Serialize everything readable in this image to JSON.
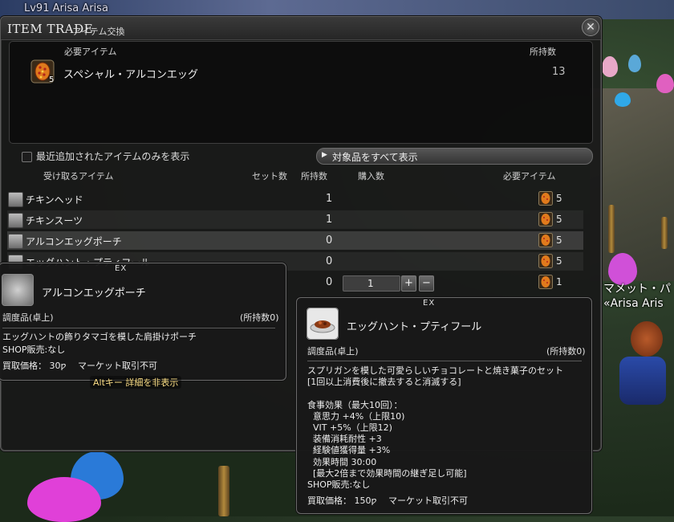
{
  "background": {
    "top_nameplate": "Lv91 Arisa Arisa",
    "right_nameplate_1": "マメット・パ",
    "right_nameplate_2": "«Arisa Aris"
  },
  "window": {
    "title_en": "ITEM TRADE",
    "title_jp": "アイテム交換",
    "close_icon": "close-x-icon"
  },
  "required": {
    "header_item": "必要アイテム",
    "header_owned": "所持数",
    "item_name": "スペシャル・アルコンエッグ",
    "item_qty_badge": "5",
    "owned": "13"
  },
  "filter": {
    "checkbox_label": "最近追加されたアイテムのみを表示",
    "show_all_button": "対象品をすべて表示"
  },
  "columns": {
    "receive": "受け取るアイテム",
    "sets": "セット数",
    "owned": "所持数",
    "purchase": "購入数",
    "required": "必要アイテム"
  },
  "rows": [
    {
      "name": "チキンヘッド",
      "owned": "1",
      "cost": "5"
    },
    {
      "name": "チキンスーツ",
      "owned": "1",
      "cost": "5"
    },
    {
      "name": "アルコンエッグポーチ",
      "owned": "0",
      "cost": "5"
    },
    {
      "name": "エッグハント・プティフール",
      "owned": "0",
      "cost": "5"
    },
    {
      "name": "",
      "owned": "0",
      "cost": "1",
      "purchase_qty": "1"
    }
  ],
  "stepper": {
    "plus": "+",
    "minus": "−"
  },
  "tooltip_left": {
    "ex": "EX",
    "name": "アルコンエッグポーチ",
    "category": "調度品(卓上)",
    "owned": "(所持数0)",
    "desc": "エッグハントの飾りタマゴを模した肩掛けポーチ",
    "shop": "SHOP販売:なし",
    "sell": "買取価格： 30ƿ　 マーケット取引不可",
    "alt_hint": "Altキー 詳細を非表示"
  },
  "tooltip_right": {
    "ex": "EX",
    "name": "エッグハント・プティフール",
    "category": "調度品(卓上)",
    "owned": "(所持数0)",
    "body": "スプリガンを模した可愛らしいチョコレートと焼き菓子のセット\n[1回以上消費後に撤去すると消滅する]\n\n食事効果（最大10回）：\n  意思力 +4%（上限10)\n  VIT +5%（上限12)\n  装備消耗耐性 +3\n  経験値獲得量 +3%\n  効果時間 30:00\n  [最大2倍まで効果時間の継ぎ足し可能]\nSHOP販売:なし",
    "sell": "買取価格： 150ƿ　 マーケット取引不可"
  },
  "colors": {
    "egg_icon_orange": "#e07a1c",
    "egg_icon_red": "#b3221c",
    "alt_hint_yellow": "#ffe28a"
  }
}
